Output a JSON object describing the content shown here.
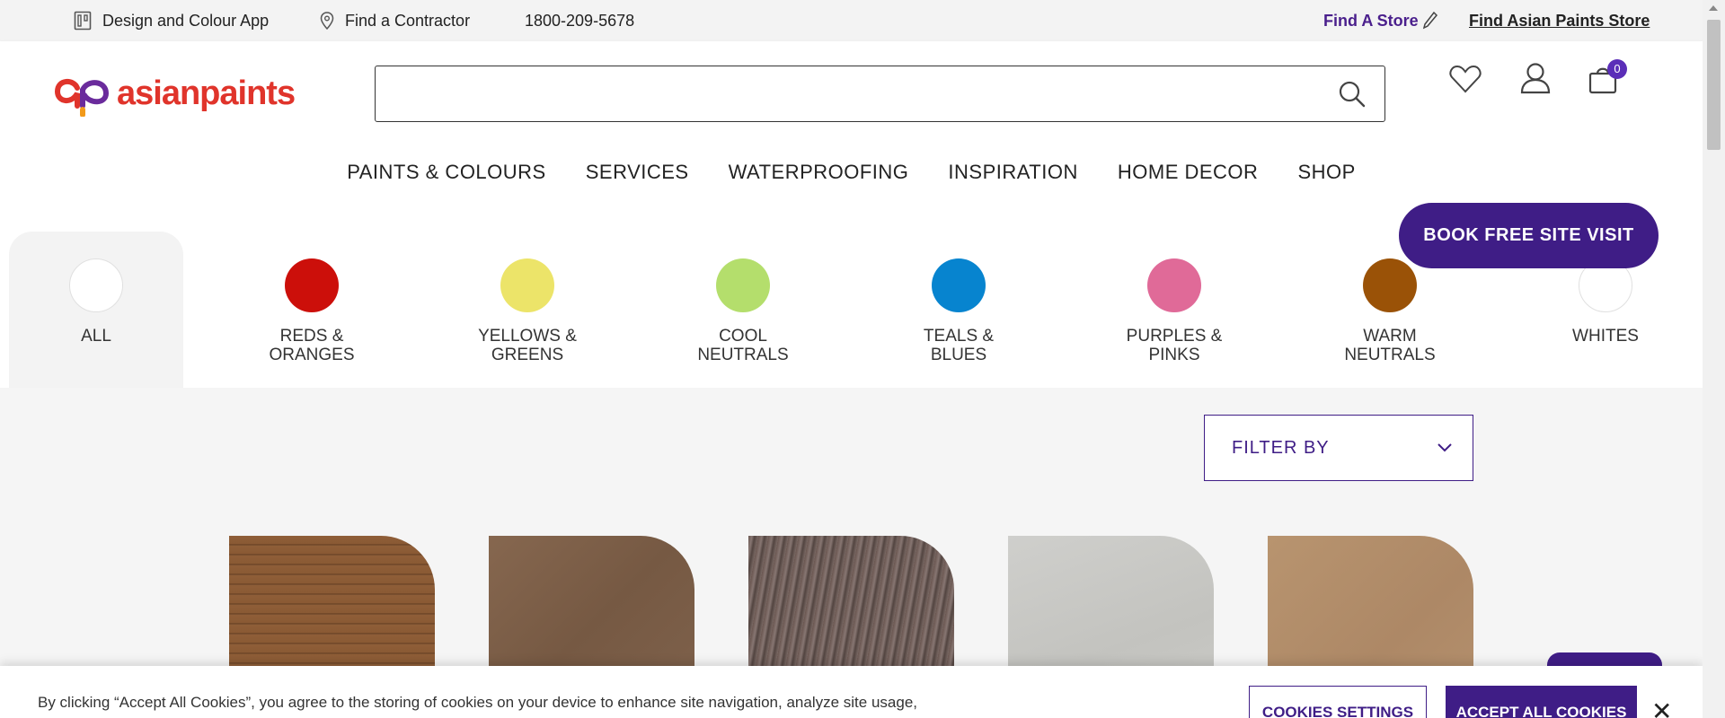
{
  "utility_bar": {
    "design_app": "Design and Colour App",
    "find_contractor": "Find a Contractor",
    "phone": "1800-209-5678",
    "find_store": "Find A Store",
    "find_ap_store": "Find Asian Paints Store"
  },
  "header": {
    "logo_text": "asianpaints",
    "search_placeholder": "",
    "cart_count": "0"
  },
  "nav": [
    "PAINTS & COLOURS",
    "SERVICES",
    "WATERPROOFING",
    "INSPIRATION",
    "HOME DECOR",
    "SHOP"
  ],
  "book_visit": "BOOK FREE SITE VISIT",
  "colour_families": [
    {
      "label": "ALL",
      "color": "#ffffff"
    },
    {
      "label": "REDS &\nORANGES",
      "color": "#cc0f0a"
    },
    {
      "label": "YELLOWS &\nGREENS",
      "color": "#ece469"
    },
    {
      "label": "COOL\nNEUTRALS",
      "color": "#b4de6c"
    },
    {
      "label": "TEALS &\nBLUES",
      "color": "#0784cf"
    },
    {
      "label": "PURPLES &\nPINKS",
      "color": "#e06a98"
    },
    {
      "label": "WARM\nNEUTRALS",
      "color": "#9a5207"
    },
    {
      "label": "WHITES",
      "color": "#ffffff"
    }
  ],
  "filter": {
    "label": "FILTER BY"
  },
  "tiles": [
    {
      "name": "wood-texture",
      "color": "#8a5a36"
    },
    {
      "name": "leather-texture",
      "color": "#7d5f4a"
    },
    {
      "name": "stone-texture",
      "color": "#6e5c56"
    },
    {
      "name": "concrete-texture",
      "color": "#c9c9c6"
    },
    {
      "name": "sand-texture",
      "color": "#b38f6d"
    }
  ],
  "cookie": {
    "text": "By clicking “Accept All Cookies”, you agree to the storing of cookies on your device to enhance site navigation, analyze site usage, and assist in our marketing efforts.",
    "settings": "COOKIES SETTINGS",
    "accept": "ACCEPT ALL COOKIES",
    "close": "✕"
  },
  "colors": {
    "brand_purple": "#3f1d86",
    "logo_red": "#e0342b"
  }
}
